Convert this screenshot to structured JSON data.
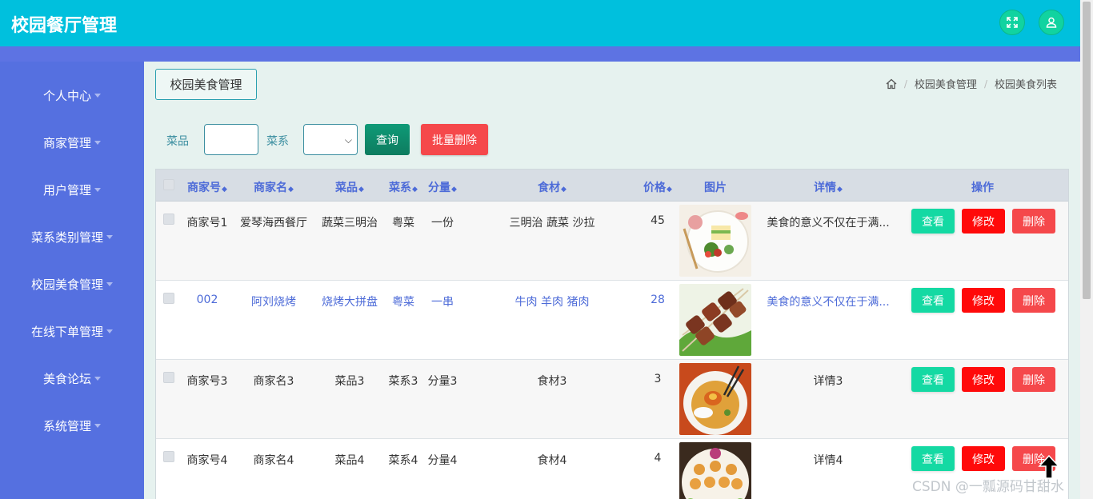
{
  "app": {
    "title": "校园餐厅管理"
  },
  "header": {
    "icons": [
      "fullscreen-icon",
      "user-icon"
    ]
  },
  "sidebar": {
    "items": [
      {
        "label": "个人中心"
      },
      {
        "label": "商家管理"
      },
      {
        "label": "用户管理"
      },
      {
        "label": "菜系类别管理"
      },
      {
        "label": "校园美食管理"
      },
      {
        "label": "在线下单管理"
      },
      {
        "label": "美食论坛"
      },
      {
        "label": "系统管理"
      }
    ]
  },
  "page": {
    "tab_label": "校园美食管理"
  },
  "breadcrumb": {
    "items": [
      "校园美食管理",
      "校园美食列表"
    ]
  },
  "filter": {
    "dish_label": "菜品",
    "dish_value": "",
    "cuisine_label": "菜系",
    "cuisine_selected": "",
    "query_label": "查询",
    "batch_delete_label": "批量删除"
  },
  "table": {
    "columns": [
      "商家号",
      "商家名",
      "菜品",
      "菜系",
      "分量",
      "食材",
      "价格",
      "图片",
      "详情",
      "操作"
    ],
    "rows": [
      {
        "merchant_id": "商家号1",
        "merchant_name": "爱琴海西餐厅",
        "dish": "蔬菜三明治",
        "cuisine": "粤菜",
        "portion": "一份",
        "ingredients": "三明治 蔬菜 沙拉",
        "price": "45",
        "image": "salad-plate",
        "detail": "美食的意义不仅在于满...",
        "view": "查看",
        "edit": "修改",
        "delete": "删除"
      },
      {
        "merchant_id": "002",
        "merchant_name": "阿刘烧烤",
        "dish": "烧烤大拼盘",
        "cuisine": "粤菜",
        "portion": "一串",
        "ingredients": "牛肉 羊肉 猪肉",
        "price": "28",
        "image": "bbq-skewers",
        "detail": "美食的意义不仅在于满...",
        "view": "查看",
        "edit": "修改",
        "delete": "删除"
      },
      {
        "merchant_id": "商家号3",
        "merchant_name": "商家名3",
        "dish": "菜品3",
        "cuisine": "菜系3",
        "portion": "分量3",
        "ingredients": "食材3",
        "price": "3",
        "image": "rice-bowl",
        "detail": "详情3",
        "view": "查看",
        "edit": "修改",
        "delete": "删除"
      },
      {
        "merchant_id": "商家号4",
        "merchant_name": "商家名4",
        "dish": "菜品4",
        "cuisine": "菜系4",
        "portion": "分量4",
        "ingredients": "食材4",
        "price": "4",
        "image": "dumpling-platter",
        "detail": "详情4",
        "view": "查看",
        "edit": "修改",
        "delete": "删除"
      }
    ]
  },
  "watermark": "CSDN @一瓢源码甘甜水",
  "colors": {
    "header": "#00c0dd",
    "sidebar": "#5570e0",
    "link_blue": "#4d6bd8",
    "view_btn": "#14d9a3",
    "edit_btn": "#ff0a0a",
    "delete_btn": "#f5484b"
  }
}
